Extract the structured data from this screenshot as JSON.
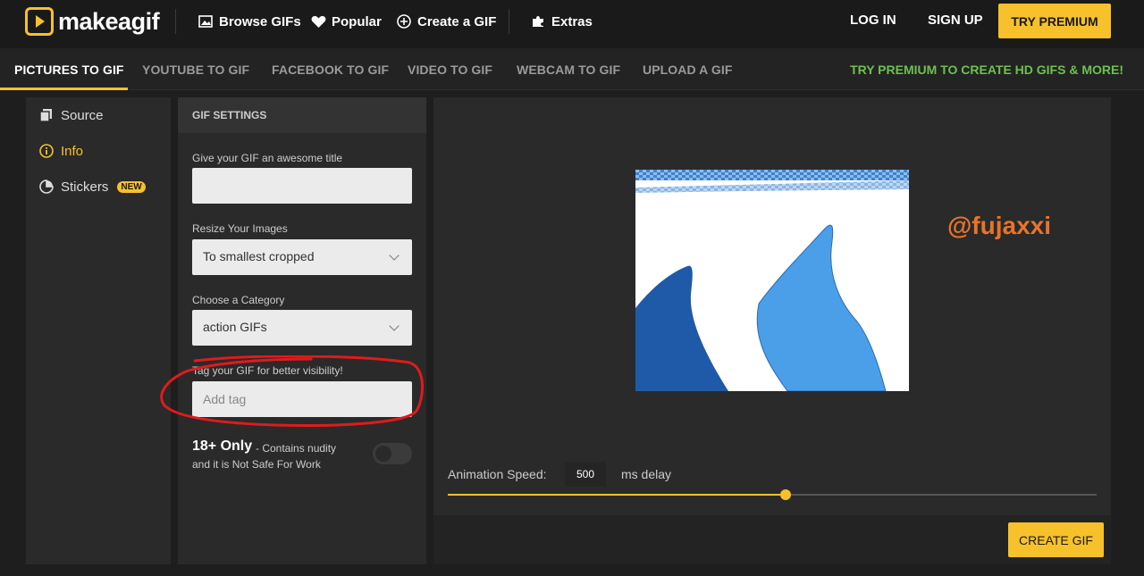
{
  "brand": {
    "logo_text": "makeagif"
  },
  "header": {
    "nav": [
      {
        "label": "Browse GIFs",
        "icon": "image-icon"
      },
      {
        "label": "Popular",
        "icon": "heart-icon"
      },
      {
        "label": "Create a GIF",
        "icon": "plus-circle-icon"
      },
      {
        "label": "Extras",
        "icon": "puzzle-icon"
      }
    ],
    "login": "LOG IN",
    "signup": "SIGN UP",
    "premium": "TRY PREMIUM"
  },
  "subnav": {
    "tabs": [
      {
        "label": "PICTURES TO GIF",
        "active": true
      },
      {
        "label": "YOUTUBE TO GIF"
      },
      {
        "label": "FACEBOOK TO GIF"
      },
      {
        "label": "VIDEO TO GIF"
      },
      {
        "label": "WEBCAM TO GIF"
      },
      {
        "label": "UPLOAD A GIF"
      }
    ],
    "promo": "TRY PREMIUM TO CREATE HD GIFS & MORE!"
  },
  "sidebar": {
    "items": [
      {
        "label": "Source",
        "icon": "copy-icon"
      },
      {
        "label": "Info",
        "icon": "info-icon",
        "active": true
      },
      {
        "label": "Stickers",
        "icon": "sticker-icon",
        "badge": "NEW"
      }
    ]
  },
  "settings": {
    "heading": "GIF SETTINGS",
    "title_label": "Give your GIF an awesome title",
    "title_value": "",
    "resize_label": "Resize Your Images",
    "resize_value": "To smallest cropped",
    "category_label": "Choose a Category",
    "category_value": "action GIFs",
    "tag_label": "Tag your GIF for better visibility!",
    "tag_placeholder": "Add tag",
    "nsfw_title": "18+ Only",
    "nsfw_desc_1": "- Contains nudity",
    "nsfw_desc_2": "and it is Not Safe For Work",
    "nsfw_enabled": false
  },
  "preview": {
    "watermark": "@fujaxxi",
    "speed_label": "Animation Speed:",
    "speed_value": "500",
    "speed_unit": "ms delay",
    "speed_fraction": 0.52
  },
  "actions": {
    "create": "CREATE GIF"
  },
  "colors": {
    "accent": "#f6c12b",
    "promo": "#6dc04f",
    "annotation": "#e01b1b",
    "watermark": "#e8742a"
  }
}
